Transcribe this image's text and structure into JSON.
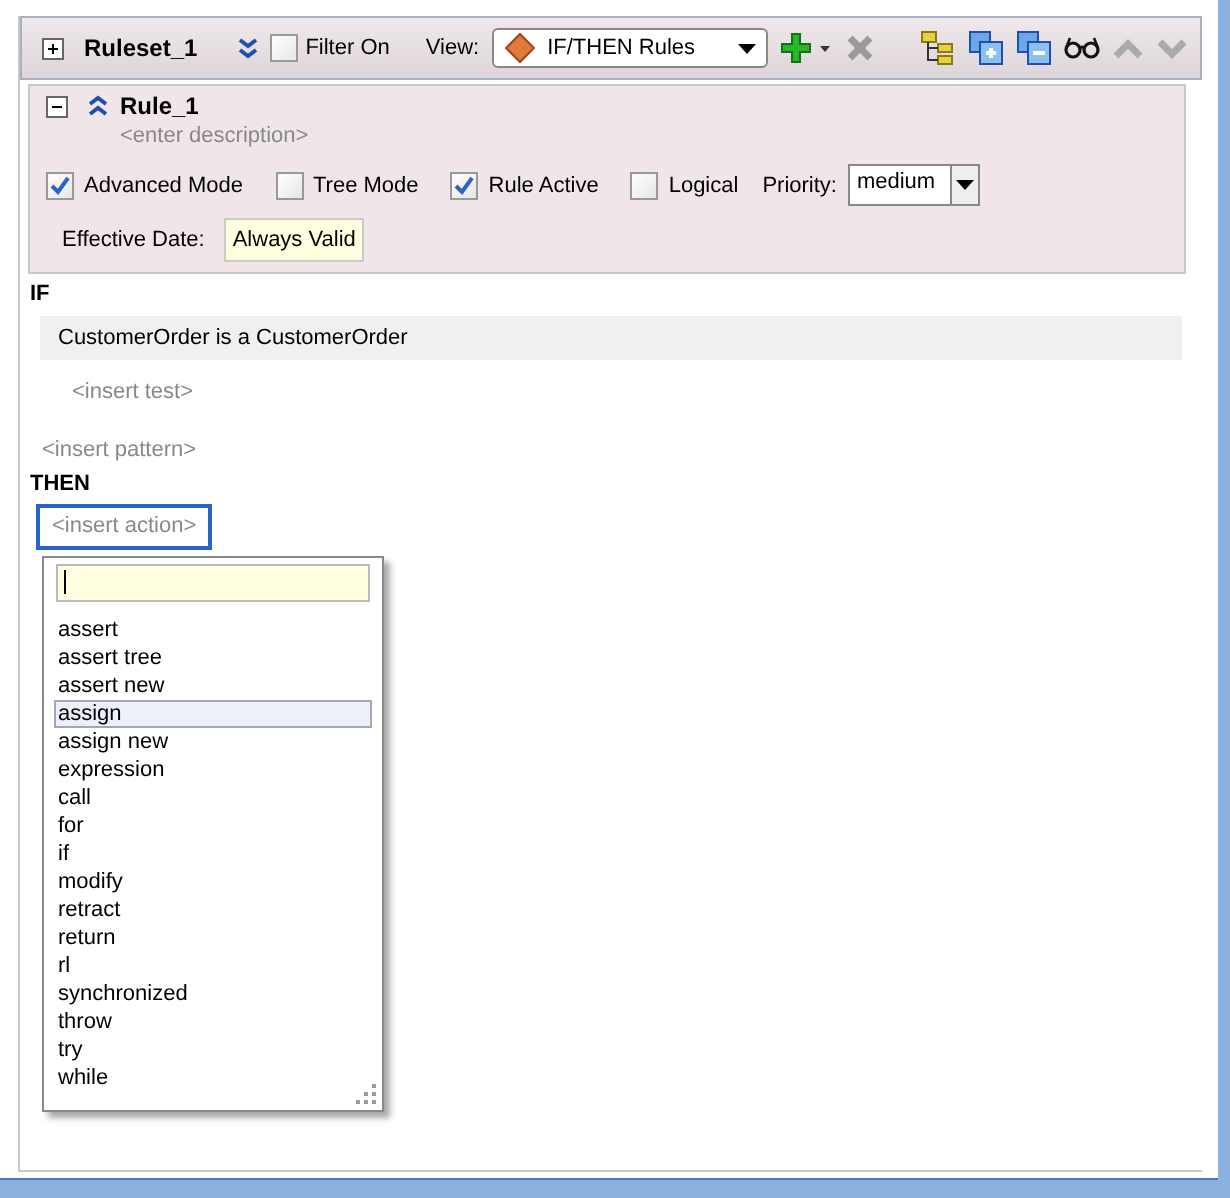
{
  "ruleset": {
    "title": "Ruleset_1",
    "filter": {
      "label": "Filter On",
      "checked": false
    },
    "view_label": "View:",
    "view_value": "IF/THEN Rules"
  },
  "toolbar": [
    {
      "kind": "add",
      "disabled": false
    },
    {
      "kind": "delete",
      "disabled": true
    },
    {
      "kind": "tree",
      "disabled": false
    },
    {
      "kind": "expand",
      "disabled": false
    },
    {
      "kind": "collapse",
      "disabled": false
    },
    {
      "kind": "glasses",
      "disabled": false
    },
    {
      "kind": "up",
      "disabled": true
    },
    {
      "kind": "down",
      "disabled": true
    }
  ],
  "rule": {
    "title": "Rule_1",
    "description": "<enter description>",
    "options": [
      {
        "label": "Advanced Mode",
        "checked": true
      },
      {
        "label": "Tree Mode",
        "checked": false
      },
      {
        "label": "Rule Active",
        "checked": true
      },
      {
        "label": "Logical",
        "checked": false
      }
    ],
    "priority_label": "Priority:",
    "priority": "medium",
    "effective_date_label": "Effective Date:",
    "effective_date": "Always Valid"
  },
  "if": {
    "heading": "IF",
    "pattern": "CustomerOrder is a CustomerOrder",
    "insert_test": "<insert test>",
    "insert_pattern": "<insert pattern>"
  },
  "then": {
    "heading": "THEN",
    "insert_action": "<insert action>"
  },
  "action_menu": {
    "items": [
      {
        "label": "assert",
        "selected": false
      },
      {
        "label": "assert tree",
        "selected": false
      },
      {
        "label": "assert new",
        "selected": false
      },
      {
        "label": "assign",
        "selected": true
      },
      {
        "label": "assign new",
        "selected": false
      },
      {
        "label": "expression",
        "selected": false
      },
      {
        "label": "call",
        "selected": false
      },
      {
        "label": "for",
        "selected": false
      },
      {
        "label": "if",
        "selected": false
      },
      {
        "label": "modify",
        "selected": false
      },
      {
        "label": "retract",
        "selected": false
      },
      {
        "label": "return",
        "selected": false
      },
      {
        "label": "rl",
        "selected": false
      },
      {
        "label": "synchronized",
        "selected": false
      },
      {
        "label": "throw",
        "selected": false
      },
      {
        "label": "try",
        "selected": false
      },
      {
        "label": "while",
        "selected": false
      }
    ]
  }
}
